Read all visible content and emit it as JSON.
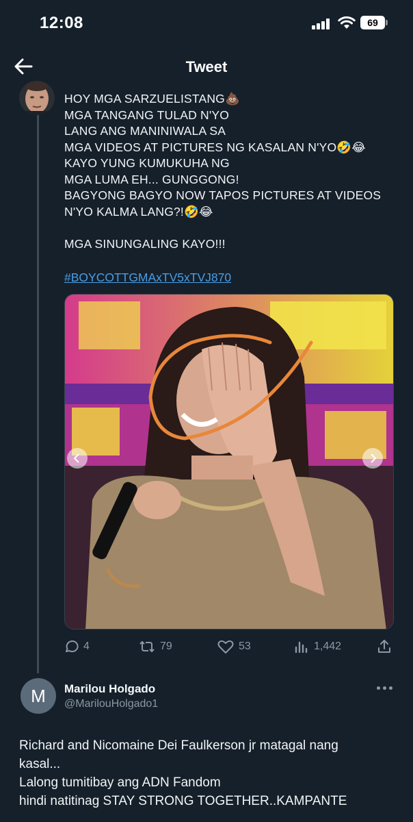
{
  "status_bar": {
    "time": "12:08",
    "battery": "69"
  },
  "nav": {
    "title": "Tweet"
  },
  "tweet": {
    "lines": [
      "HOY MGA SARZUELISTANG💩",
      "MGA TANGANG TULAD N'YO",
      "LANG ANG MANINIWALA SA",
      "MGA VIDEOS AT PICTURES NG KASALAN N'YO🤣😂",
      "KAYO YUNG KUMUKUHA NG",
      "MGA LUMA EH... GUNGGONG!",
      "BAGYONG BAGYO NOW TAPOS PICTURES AT VIDEOS",
      "N'YO KALMA LANG?!🤣😂",
      "",
      "MGA SINUNGALING KAYO!!!"
    ],
    "hashtag": "#BOYCOTTGMAxTV5xTVJ870",
    "actions": {
      "replies": "4",
      "retweets": "79",
      "likes": "53",
      "views": "1,442"
    }
  },
  "reply": {
    "avatar_letter": "M",
    "name": "Marilou Holgado",
    "handle": "@MarilouHolgado1",
    "lines": [
      "Richard and Nicomaine Dei Faulkerson jr matagal nang",
      "kasal...",
      "Lalong tumitibay ang ADN Fandom",
      "hindi natitinag STAY STRONG TOGETHER..KAMPANTE"
    ]
  },
  "colors": {
    "background": "#15202b",
    "link": "#4a9ee6",
    "muted": "#8b98a5",
    "annotation": "#e8873a"
  }
}
